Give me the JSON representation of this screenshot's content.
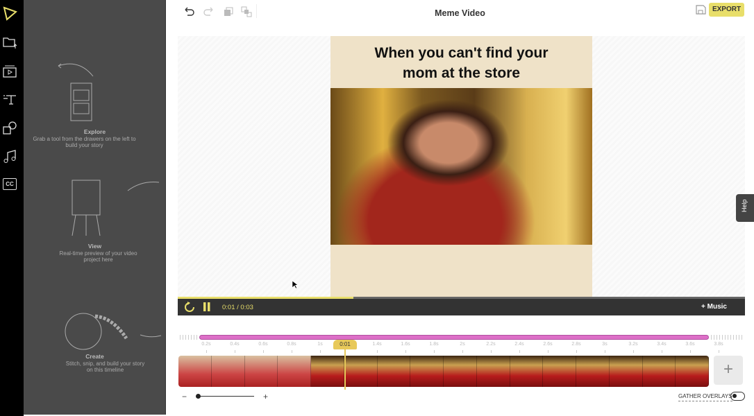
{
  "app": {
    "title": "Meme Video",
    "export_label": "EXPORT",
    "help_label": "Help",
    "accent": "#e8de6a"
  },
  "rail": [
    {
      "icon": "logo-icon"
    },
    {
      "icon": "folder-upload-icon"
    },
    {
      "icon": "media-icon"
    },
    {
      "icon": "text-icon"
    },
    {
      "icon": "shapes-icon"
    },
    {
      "icon": "music-icon"
    },
    {
      "icon": "captions-icon"
    }
  ],
  "rail_cc": "CC",
  "drawer": {
    "explore": {
      "title": "Explore",
      "text": "Grab a tool from the drawers on the left to build your story"
    },
    "view": {
      "title": "View",
      "text": "Real-time preview of your video project here"
    },
    "create": {
      "title": "Create",
      "text": "Stitch, snip, and build your story on this timeline"
    }
  },
  "preview": {
    "caption_line1": "When you can't find your",
    "caption_line2": "mom at the store"
  },
  "player": {
    "time": "0:01 / 0:03",
    "progress": 0.31,
    "music_label": "+ Music"
  },
  "timeline": {
    "playhead_label": "0:01",
    "ticks": [
      "0.2s",
      "0.4s",
      "0.6s",
      "0.8s",
      "1s",
      "1.2s",
      "1.4s",
      "1.6s",
      "1.8s",
      "2s",
      "2.2s",
      "2.4s",
      "2.6s",
      "2.8s",
      "3s",
      "3.2s",
      "3.4s",
      "3.6s",
      "3.8s"
    ],
    "add_label": "+",
    "zoom_minus": "−",
    "zoom_plus": "+",
    "gather_overlays": "GATHER OVERLAYS"
  }
}
